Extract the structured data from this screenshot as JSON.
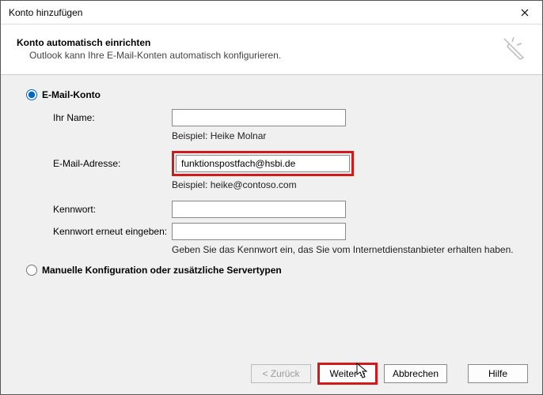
{
  "window": {
    "title": "Konto hinzufügen"
  },
  "header": {
    "title": "Konto automatisch einrichten",
    "subtitle": "Outlook kann Ihre E-Mail-Konten automatisch konfigurieren."
  },
  "radios": {
    "email_account": "E-Mail-Konto",
    "manual": "Manuelle Konfiguration oder zusätzliche Servertypen"
  },
  "form": {
    "name": {
      "label": "Ihr Name:",
      "value": "",
      "example": "Beispiel: Heike Molnar"
    },
    "email": {
      "label": "E-Mail-Adresse:",
      "value": "funktionspostfach@hsbi.de",
      "example": "Beispiel: heike@contoso.com"
    },
    "password": {
      "label": "Kennwort:",
      "value": ""
    },
    "password2": {
      "label": "Kennwort erneut eingeben:",
      "value": "",
      "hint": "Geben Sie das Kennwort ein, das Sie vom Internetdienstanbieter erhalten haben."
    }
  },
  "buttons": {
    "back": "< Zurück",
    "next": "Weiter >",
    "cancel": "Abbrechen",
    "help": "Hilfe"
  }
}
